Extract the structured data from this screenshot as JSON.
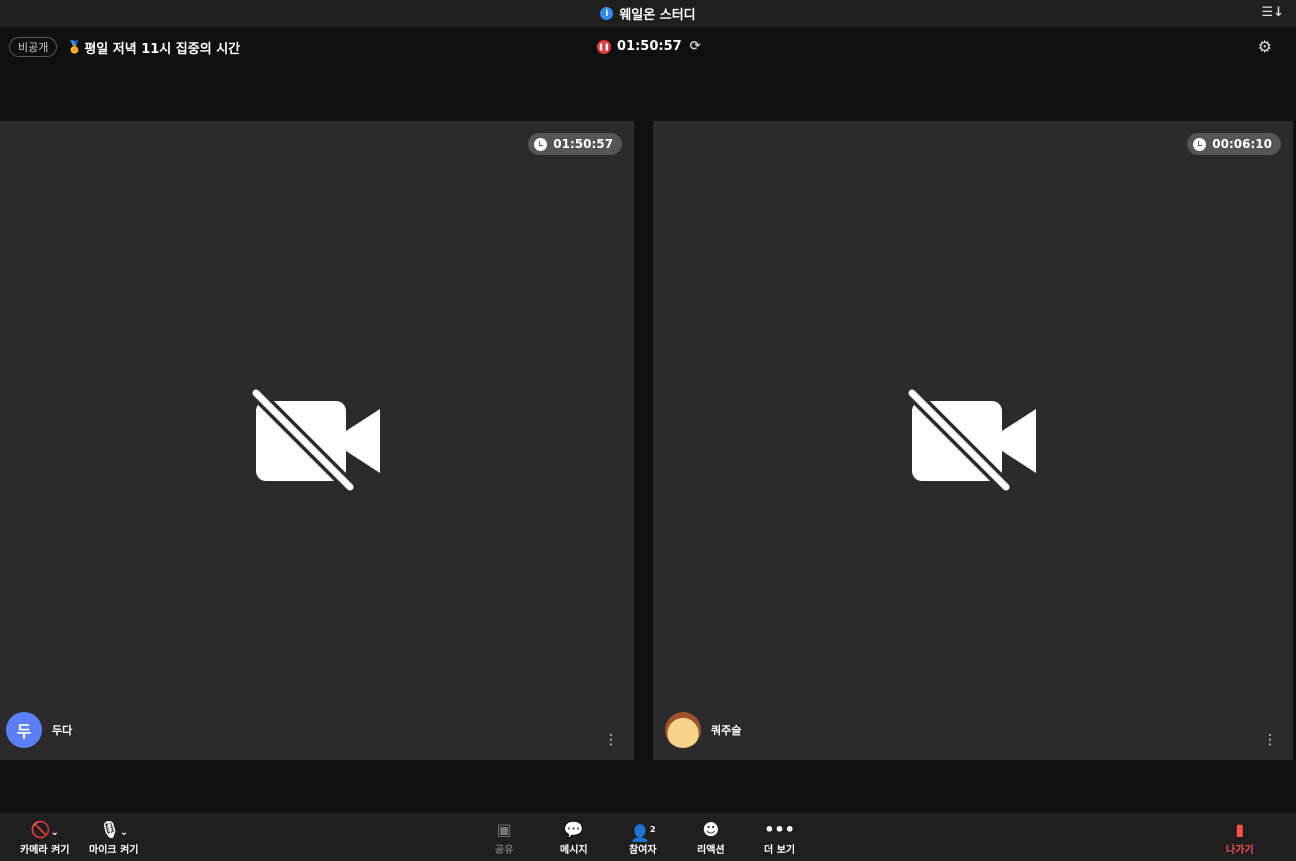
{
  "window": {
    "title": "웨일온 스터디"
  },
  "header": {
    "privacy_badge": "비공개",
    "room_title": "평일 저녁 11시 집중의 시간",
    "session_timer": "01:50:57"
  },
  "tiles": [
    {
      "name": "두다",
      "avatar_letter": "두",
      "timer": "01:50:57",
      "avatar_color": "#5b7ff5"
    },
    {
      "name": "쿼주슬",
      "timer": "00:06:10"
    }
  ],
  "toolbar": {
    "camera": "카메라 켜기",
    "mic": "마이크 켜기",
    "share": "공유",
    "message": "메시지",
    "participants": "참여자",
    "participants_count": "2",
    "reaction": "리액션",
    "more": "더 보기",
    "leave": "나가기"
  }
}
